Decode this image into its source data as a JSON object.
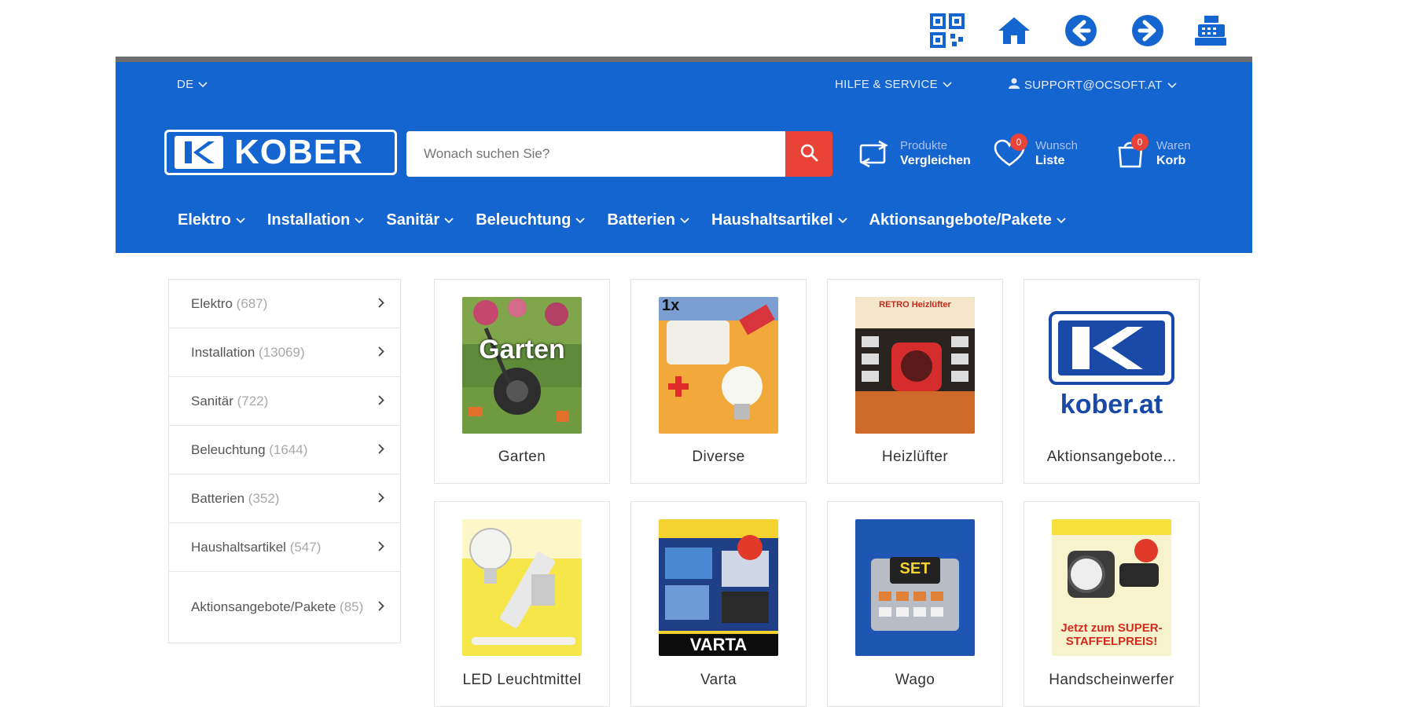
{
  "toolbar": {
    "icons": [
      "qr-code-icon",
      "home-icon",
      "back-arrow-icon",
      "forward-arrow-icon",
      "cash-register-icon"
    ]
  },
  "utility": {
    "language": "DE",
    "help": "HILFE & SERVICE",
    "account": "SUPPORT@OCSOFT.AT"
  },
  "brand": {
    "logo_text": "KOBER"
  },
  "search": {
    "placeholder": "Wonach suchen Sie?"
  },
  "header_actions": {
    "compare": {
      "line1": "Produkte",
      "line2": "Vergleichen"
    },
    "wishlist": {
      "line1": "Wunsch",
      "line2": "Liste",
      "badge": "0"
    },
    "cart": {
      "line1": "Waren",
      "line2": "Korb",
      "badge": "0"
    }
  },
  "nav": {
    "items": [
      "Elektro",
      "Installation",
      "Sanitär",
      "Beleuchtung",
      "Batterien",
      "Haushaltsartikel",
      "Aktionsangebote/Pakete"
    ]
  },
  "sidebar": {
    "items": [
      {
        "label": "Elektro",
        "count": "(687)"
      },
      {
        "label": "Installation",
        "count": "(13069)"
      },
      {
        "label": "Sanitär",
        "count": "(722)"
      },
      {
        "label": "Beleuchtung",
        "count": "(1644)"
      },
      {
        "label": "Batterien",
        "count": "(352)"
      },
      {
        "label": "Haushaltsartikel",
        "count": "(547)"
      },
      {
        "label": "Aktionsangebote/Pakete",
        "count": "(85)"
      }
    ]
  },
  "categories": [
    {
      "caption": "Garten",
      "thumb_text": "Garten"
    },
    {
      "caption": "Diverse",
      "thumb_text": "1x"
    },
    {
      "caption": "Heizlüfter",
      "thumb_text": "RETRO Heizlüfter"
    },
    {
      "caption": "Aktionsangebote...",
      "thumb_text": "kober.at"
    },
    {
      "caption": "LED Leuchtmittel",
      "thumb_text": ""
    },
    {
      "caption": "Varta",
      "thumb_text": "VARTA"
    },
    {
      "caption": "Wago",
      "thumb_text": "SET"
    },
    {
      "caption": "Handscheinwerfer",
      "thumb_text": "Jetzt zum SUPER-STAFFELPREIS!"
    }
  ],
  "colors": {
    "brand_blue": "#1565d0",
    "accent_red": "#e94236"
  }
}
